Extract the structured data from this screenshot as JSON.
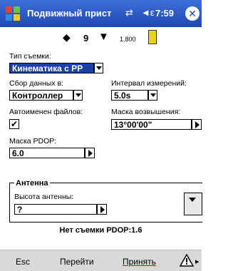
{
  "window": {
    "title": "Подвижный прист",
    "time": "7:59",
    "connection_icon": "⇄",
    "volume_icon": "◄ε",
    "close_label": "✕"
  },
  "status": {
    "satellites": "9",
    "antenna_height": "1.800"
  },
  "form": {
    "survey_type": {
      "label": "Тип съемки:",
      "value": "Кинематика с PP"
    },
    "data_logging": {
      "label": "Сбор данных в:",
      "value": "Контроллер"
    },
    "interval": {
      "label": "Интервал измерений:",
      "value": "5.0s"
    },
    "auto_files": {
      "label": "Автоименен файлов:",
      "checked": "✔"
    },
    "elevation_mask": {
      "label": "Маска возвышения:",
      "value": "13°00'00\""
    },
    "pdop_mask": {
      "label": "Маска PDOP:",
      "value": "6.0"
    },
    "antenna_group": {
      "title": "Антенна",
      "height_label": "Высота антенны:",
      "height_value": "?"
    }
  },
  "footer_status": "Нет съемки PDOP:1.6",
  "commands": {
    "esc": "Esc",
    "go": "Перейти",
    "accept": "Принять"
  },
  "colors": {
    "titlebar": "#1e49b3",
    "selection": "#1a3fa8",
    "cmdbar": "#d9d9d9"
  }
}
